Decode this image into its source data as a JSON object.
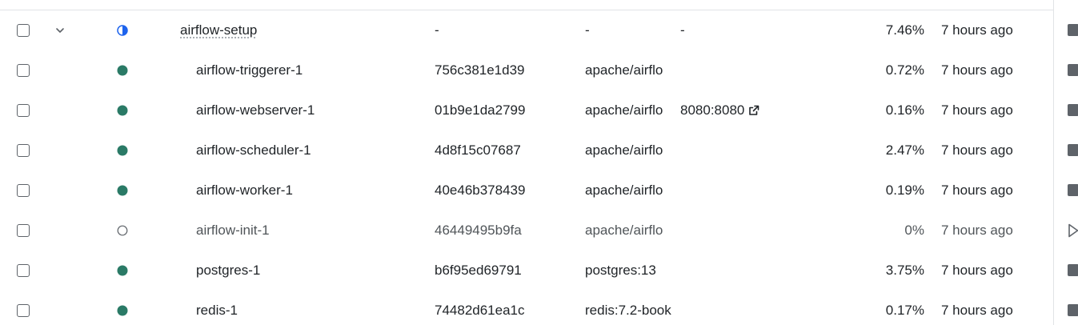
{
  "colors": {
    "running": "#2a7a66",
    "partial": "#1d63ed",
    "stopped_outline": "#5e6369",
    "divider": "#e1e3e6"
  },
  "group": {
    "name": "airflow-setup",
    "container_id": "-",
    "image": "-",
    "port": "-",
    "cpu": "7.46%",
    "last_started": "7 hours ago",
    "status": "partial",
    "expand_icon": "chevron-down-icon"
  },
  "containers": [
    {
      "name": "airflow-triggerer-1",
      "container_id": "756c381e1d39",
      "image": "apache/airflo",
      "port": "",
      "cpu": "0.72%",
      "last_started": "7 hours ago",
      "status": "running"
    },
    {
      "name": "airflow-webserver-1",
      "container_id": "01b9e1da2799",
      "image": "apache/airflo",
      "port": "8080:8080",
      "cpu": "0.16%",
      "last_started": "7 hours ago",
      "status": "running"
    },
    {
      "name": "airflow-scheduler-1",
      "container_id": "4d8f15c07687",
      "image": "apache/airflo",
      "port": "",
      "cpu": "2.47%",
      "last_started": "7 hours ago",
      "status": "running"
    },
    {
      "name": "airflow-worker-1",
      "container_id": "40e46b378439",
      "image": "apache/airflo",
      "port": "",
      "cpu": "0.19%",
      "last_started": "7 hours ago",
      "status": "running"
    },
    {
      "name": "airflow-init-1",
      "container_id": "46449495b9fa",
      "image": "apache/airflo",
      "port": "",
      "cpu": "0%",
      "last_started": "7 hours ago",
      "status": "stopped"
    },
    {
      "name": "postgres-1",
      "container_id": "b6f95ed69791",
      "image": "postgres:13",
      "port": "",
      "cpu": "3.75%",
      "last_started": "7 hours ago",
      "status": "running"
    },
    {
      "name": "redis-1",
      "container_id": "74482d61ea1c",
      "image": "redis:7.2-book",
      "port": "",
      "cpu": "0.17%",
      "last_started": "7 hours ago",
      "status": "running"
    }
  ]
}
